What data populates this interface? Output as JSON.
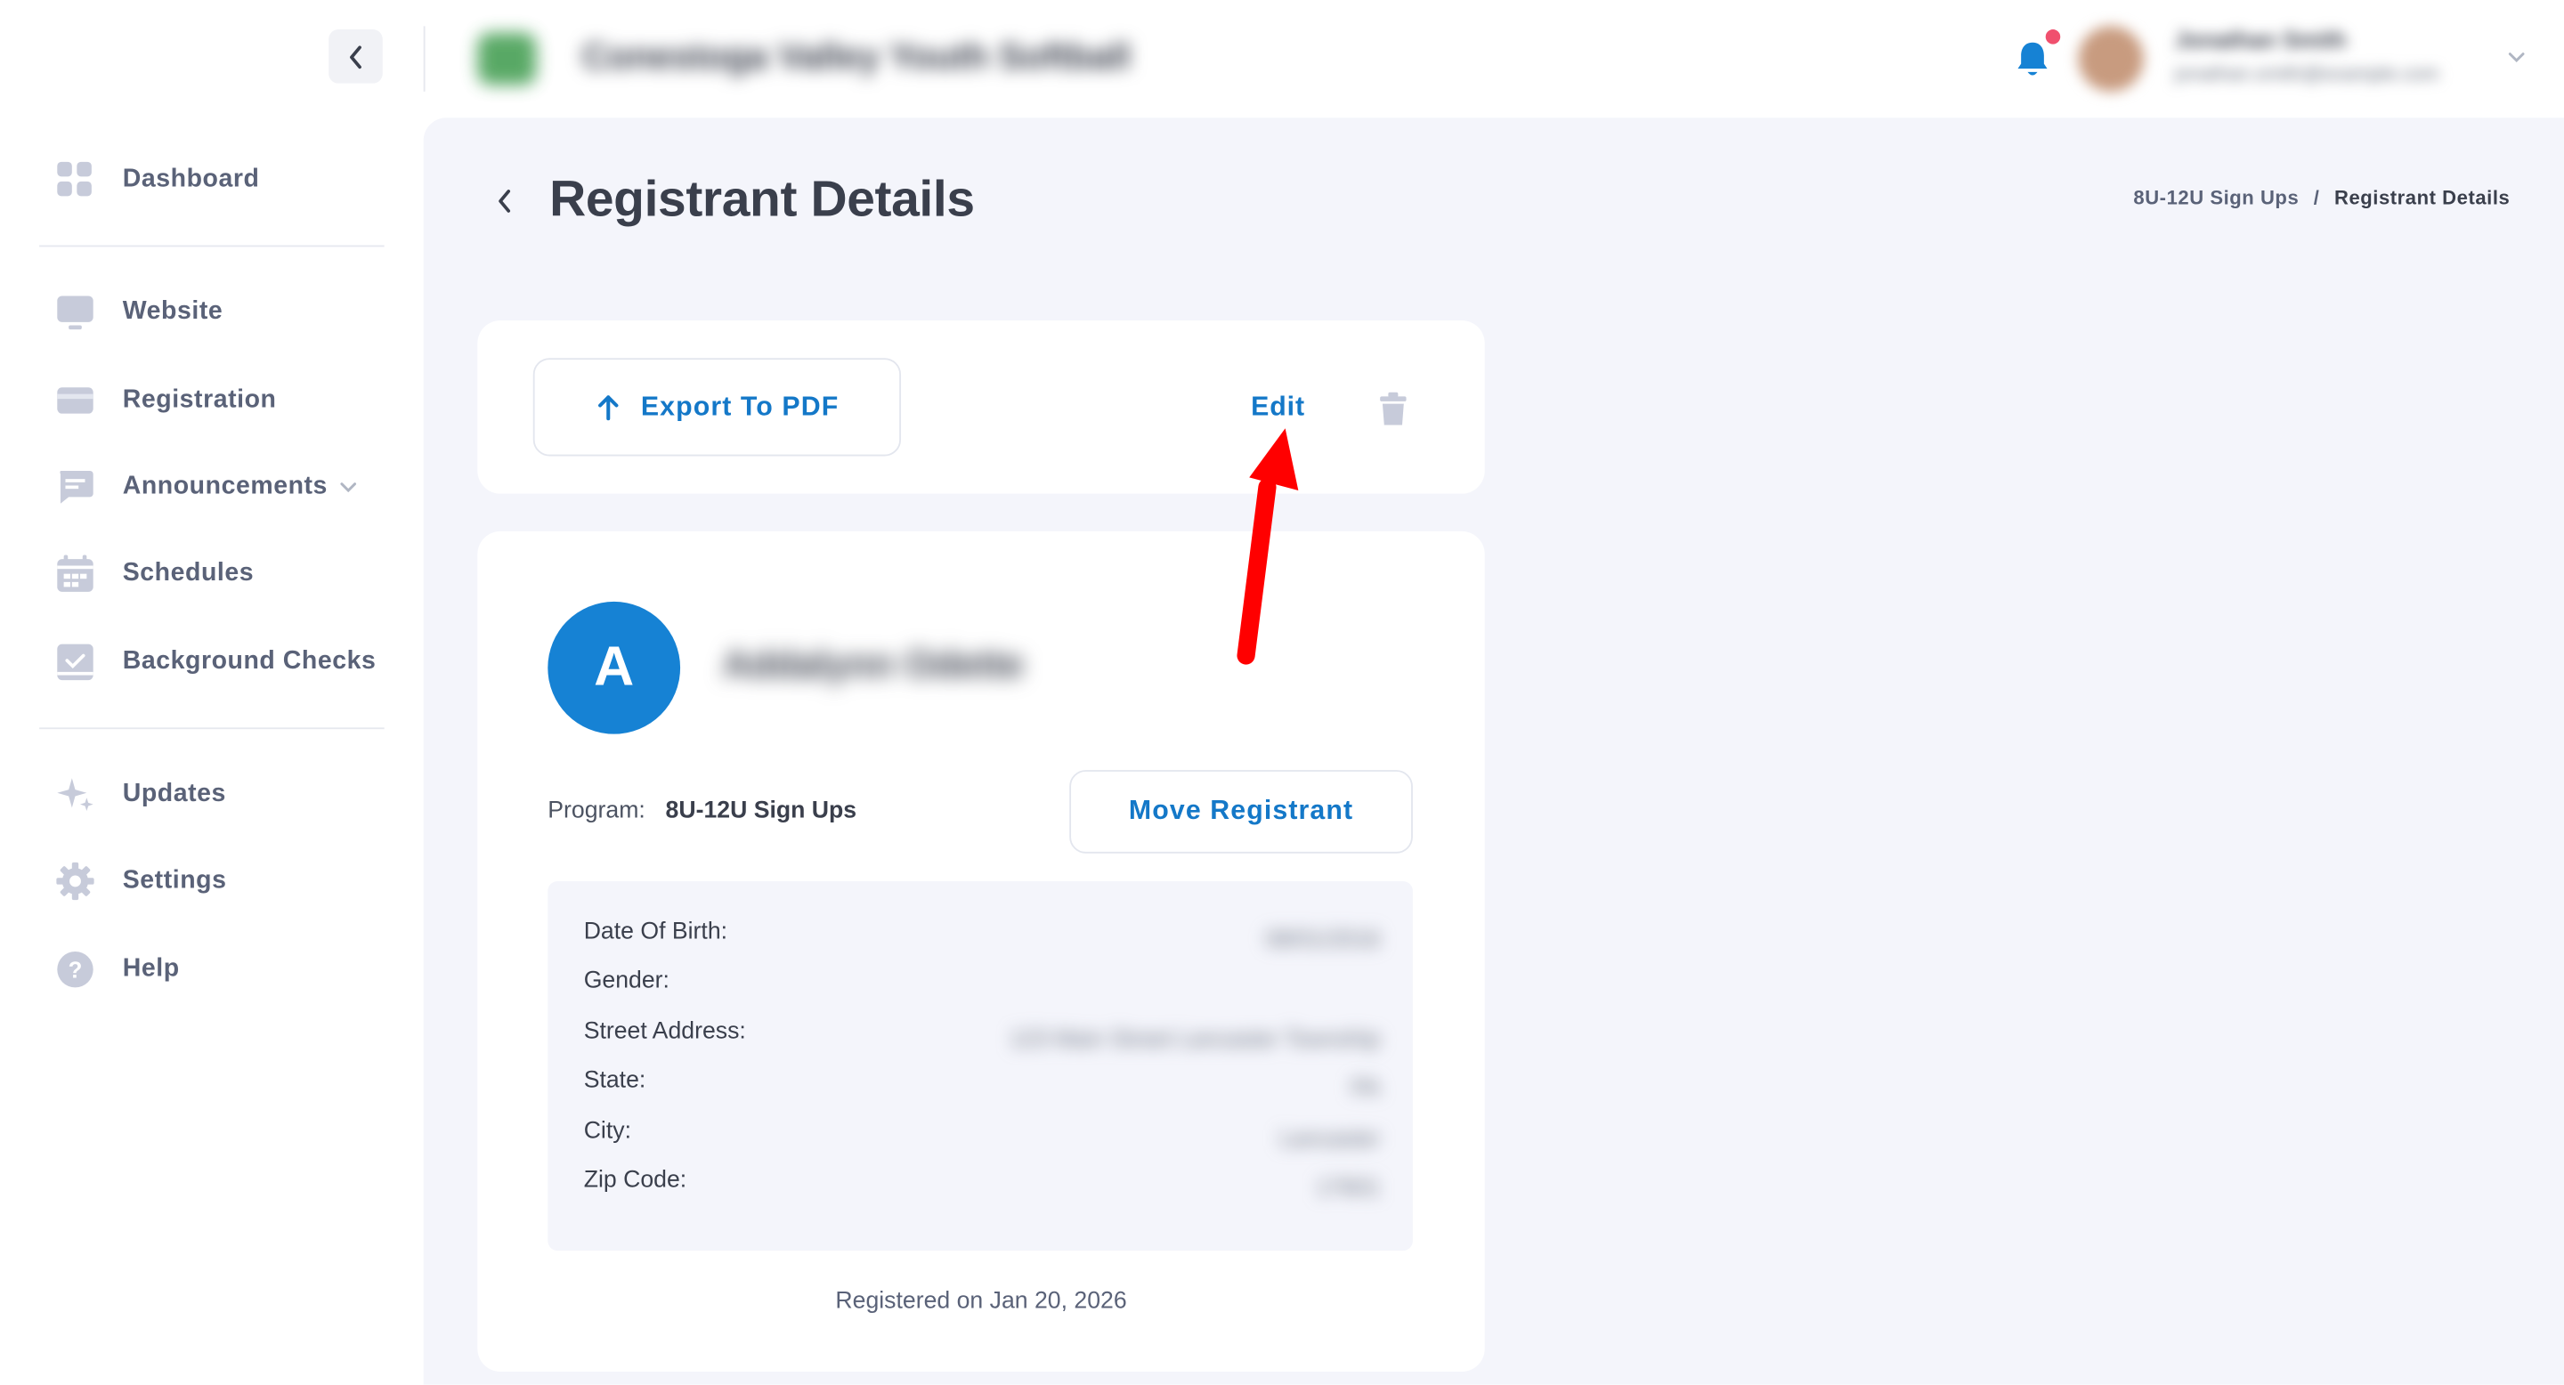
{
  "header": {
    "org_name": "Conestoga Valley Youth Softball",
    "user_name": "Jonathan Smith",
    "user_email": "jonathan.smith@example.com"
  },
  "sidebar": {
    "items": [
      {
        "label": "Dashboard",
        "icon": "dashboard-icon"
      },
      {
        "label": "Website",
        "icon": "monitor-icon"
      },
      {
        "label": "Registration",
        "icon": "card-icon"
      },
      {
        "label": "Announcements",
        "icon": "message-icon"
      },
      {
        "label": "Schedules",
        "icon": "calendar-icon"
      },
      {
        "label": "Background Checks",
        "icon": "checklist-icon"
      },
      {
        "label": "Updates",
        "icon": "sparkle-icon"
      },
      {
        "label": "Settings",
        "icon": "gear-icon"
      },
      {
        "label": "Help",
        "icon": "help-icon"
      }
    ]
  },
  "page": {
    "title": "Registrant Details",
    "breadcrumb": {
      "parent": "8U-12U Sign Ups",
      "separator": "/",
      "current": "Registrant Details"
    }
  },
  "actions": {
    "export_label": "Export To PDF",
    "edit_label": "Edit"
  },
  "registrant": {
    "initial": "A",
    "name": "Addalynn Odette",
    "program_label": "Program:",
    "program_value": "8U-12U Sign Ups",
    "move_label": "Move Registrant",
    "fields": [
      {
        "label": "Date Of Birth:",
        "value": "08/01/2016"
      },
      {
        "label": "Gender:",
        "value": ""
      },
      {
        "label": "Street Address:",
        "value": "123 Main Street Lancaster Township"
      },
      {
        "label": "State:",
        "value": "PA"
      },
      {
        "label": "City:",
        "value": "Lancaster"
      },
      {
        "label": "Zip Code:",
        "value": "17601"
      }
    ],
    "registered_on": "Registered on Jan 20, 2026"
  },
  "colors": {
    "accent": "#1478c8",
    "avatar": "#1682d4",
    "notification_dot": "#f0506e",
    "annotation_arrow": "#ff0000"
  }
}
